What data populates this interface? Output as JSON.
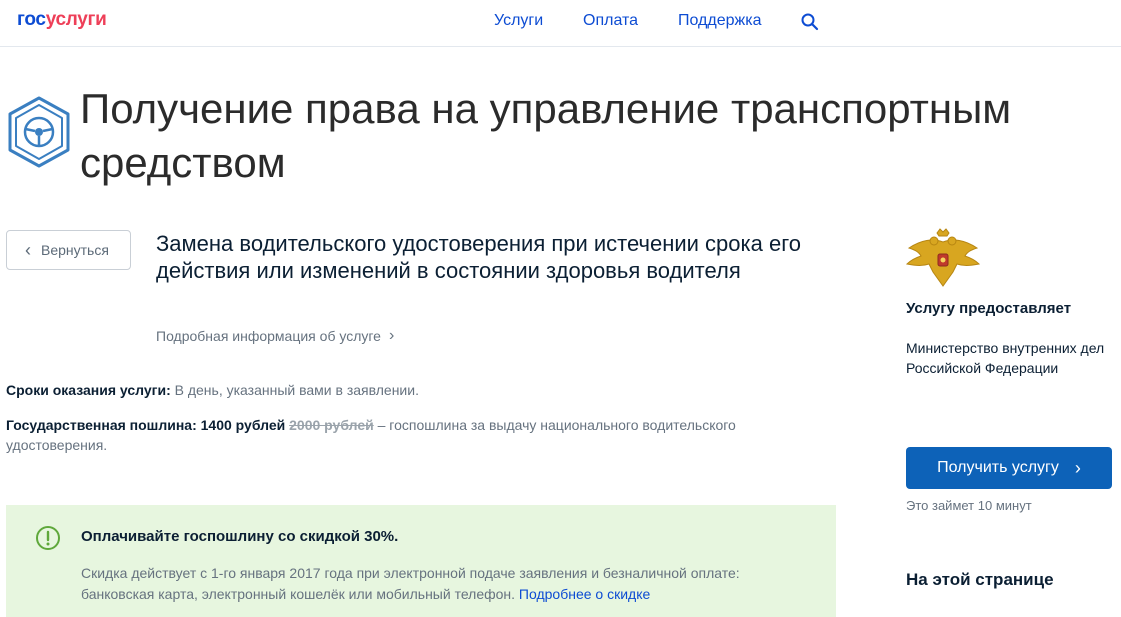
{
  "header": {
    "logo_part1": "гос",
    "logo_part2": "услуги",
    "nav": [
      "Услуги",
      "Оплата",
      "Поддержка"
    ],
    "search_icon": "search-icon"
  },
  "page": {
    "title": "Получение права на управление транспортным средством",
    "hero_icon": "steering-wheel-icon"
  },
  "service": {
    "back_label": "Вернуться",
    "title": "Замена водительского удостоверения при истечении срока его действия или изменений в состоянии здоровья водителя",
    "details_link": "Подробная информация об услуге",
    "terms_label": "Сроки оказания услуги:",
    "terms_value": "В день, указанный вами в заявлении.",
    "fee_label": "Государственная пошлина:",
    "fee_new": "1400 рублей",
    "fee_old": "2000 рублей",
    "fee_note": "– госпошлина за выдачу национального водительского удостоверения."
  },
  "discount": {
    "icon": "exclamation-circle-icon",
    "title": "Оплачивайте госпошлину со скидкой 30%.",
    "text": "Скидка действует с 1-го января 2017 года при электронной подаче заявления и безналичной оплате: банковская карта, электронный кошелёк или мобильный телефон.",
    "link": "Подробнее о скидке"
  },
  "sidebar": {
    "emblem": "double-headed-eagle-emblem",
    "provider_label": "Услугу предоставляет",
    "provider_line1": "Министерство внутренних дел",
    "provider_line2": "Российской Федерации",
    "get_button": "Получить услугу",
    "time_note": "Это займет 10 минут",
    "on_page": "На этой странице"
  },
  "colors": {
    "brand_blue": "#0d4cd3",
    "brand_red": "#ee3f58",
    "button_blue": "#0d62b8",
    "discount_bg": "#e7f6df",
    "discount_icon": "#5fa83b"
  }
}
